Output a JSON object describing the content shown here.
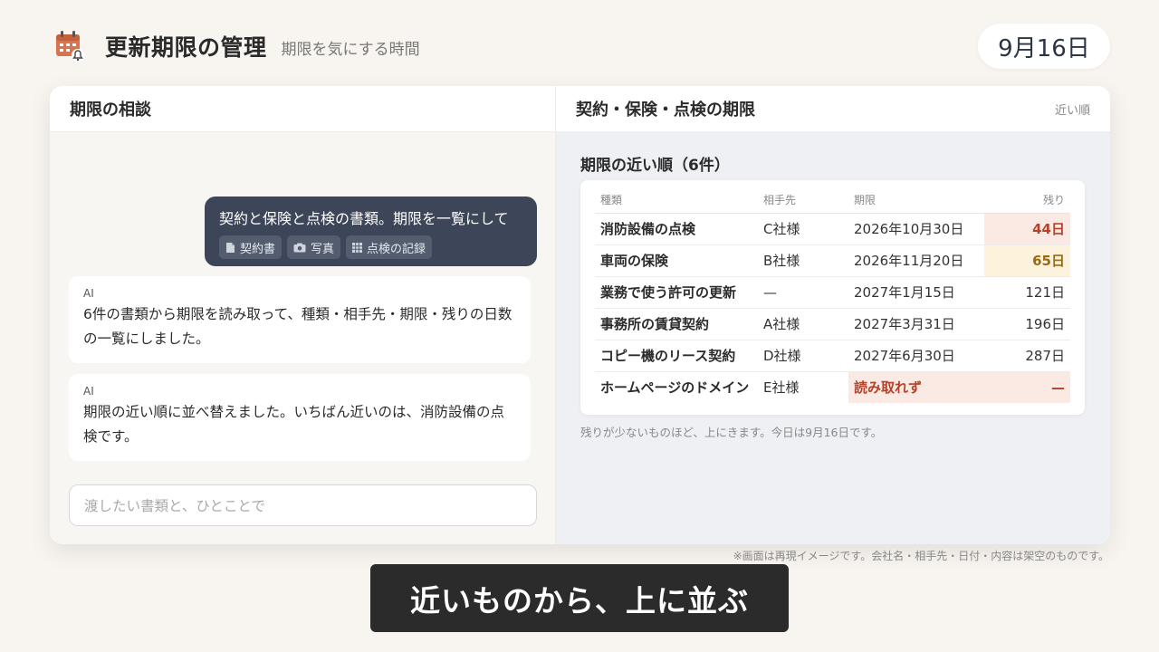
{
  "header": {
    "title": "更新期限の管理",
    "subtitle": "期限を気にする時間",
    "date": "9月16日",
    "icon": "calendar-bell-icon"
  },
  "chat": {
    "title": "期限の相談",
    "user_message": "契約と保険と点検の書類。期限を一覧にして",
    "attachments": [
      {
        "icon": "document-icon",
        "label": "契約書"
      },
      {
        "icon": "camera-icon",
        "label": "写真"
      },
      {
        "icon": "grid-icon",
        "label": "点検の記録"
      }
    ],
    "ai_messages": [
      {
        "label": "AI",
        "text": "6件の書類から期限を読み取って、種類・相手先・期限・残りの日数の一覧にしました。"
      },
      {
        "label": "AI",
        "text": "期限の近い順に並べ替えました。いちばん近いのは、消防設備の点検です。"
      }
    ],
    "input_placeholder": "渡したい書類と、ひとことで"
  },
  "deadlines": {
    "title": "契約・保険・点検の期限",
    "sort_label": "近い順",
    "list_title": "期限の近い順（6件）",
    "columns": [
      "種類",
      "相手先",
      "期限",
      "残り"
    ],
    "rows": [
      {
        "type": "消防設備の点検",
        "party": "C社様",
        "deadline": "2026年10月30日",
        "remaining": "44日",
        "status": "urgent"
      },
      {
        "type": "車両の保険",
        "party": "B社様",
        "deadline": "2026年11月20日",
        "remaining": "65日",
        "status": "warning"
      },
      {
        "type": "業務で使う許可の更新",
        "party": "—",
        "deadline": "2027年1月15日",
        "remaining": "121日",
        "status": "normal"
      },
      {
        "type": "事務所の賃貸契約",
        "party": "A社様",
        "deadline": "2027年3月31日",
        "remaining": "196日",
        "status": "normal"
      },
      {
        "type": "コピー機のリース契約",
        "party": "D社様",
        "deadline": "2027年6月30日",
        "remaining": "287日",
        "status": "normal"
      },
      {
        "type": "ホームページのドメイン",
        "party": "E社様",
        "deadline": "読み取れず",
        "remaining": "—",
        "status": "unreadable"
      }
    ],
    "note": "残りが少ないものほど、上にきます。今日は9月16日です。"
  },
  "disclaimer": "※画面は再現イメージです。会社名・相手先・日付・内容は架空のものです。",
  "caption": "近いものから、上に並ぶ",
  "colors": {
    "background": "#f8f4ef",
    "user_bubble": "#3c4658",
    "urgent": "#b5432b",
    "warning": "#9a6a12",
    "caption_bg": "#2b2b2b"
  }
}
